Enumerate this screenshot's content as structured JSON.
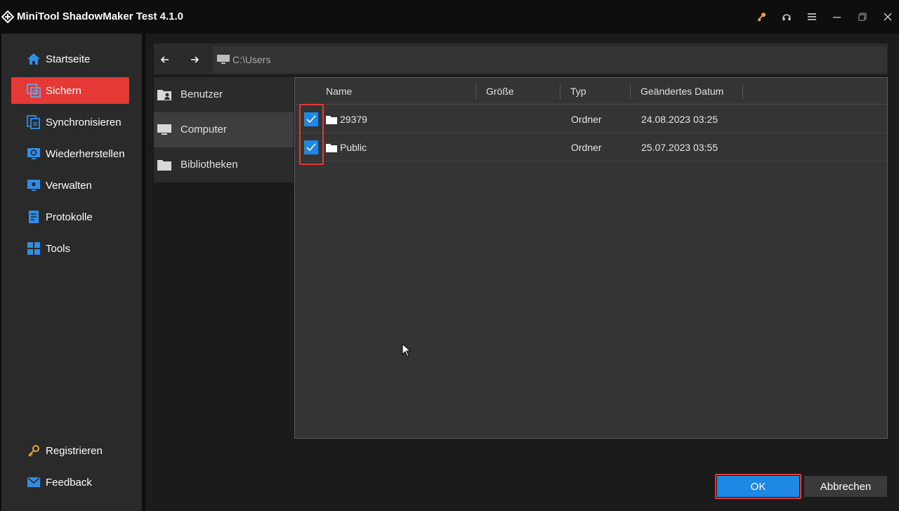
{
  "app": {
    "title": "MiniTool ShadowMaker Test 4.1.0"
  },
  "window_controls": [
    "key-icon",
    "headset-icon",
    "menu-icon",
    "minimize-icon",
    "restore-icon",
    "close-icon"
  ],
  "sidebar": {
    "items": [
      {
        "label": "Startseite",
        "icon": "home-icon",
        "active": false
      },
      {
        "label": "Sichern",
        "icon": "backup-icon",
        "active": true
      },
      {
        "label": "Synchronisieren",
        "icon": "sync-icon",
        "active": false
      },
      {
        "label": "Wiederherstellen",
        "icon": "restore-monitor-icon",
        "active": false
      },
      {
        "label": "Verwalten",
        "icon": "manage-icon",
        "active": false
      },
      {
        "label": "Protokolle",
        "icon": "log-icon",
        "active": false
      },
      {
        "label": "Tools",
        "icon": "tools-grid-icon",
        "active": false
      }
    ],
    "bottom_items": [
      {
        "label": "Registrieren",
        "icon": "key-icon"
      },
      {
        "label": "Feedback",
        "icon": "mail-icon"
      }
    ]
  },
  "navigation": {
    "path": "C:\\Users"
  },
  "locations": [
    {
      "label": "Benutzer",
      "icon": "user-folder-icon",
      "selected": false
    },
    {
      "label": "Computer",
      "icon": "computer-icon",
      "selected": true
    },
    {
      "label": "Bibliotheken",
      "icon": "folder-icon",
      "selected": false
    }
  ],
  "file_list": {
    "columns": [
      "Name",
      "Größe",
      "Typ",
      "Geändertes Datum"
    ],
    "rows": [
      {
        "checked": true,
        "name": "29379",
        "size": "",
        "type": "Ordner",
        "date": "24.08.2023 03:25"
      },
      {
        "checked": true,
        "name": "Public",
        "size": "",
        "type": "Ordner",
        "date": "25.07.2023 03:55"
      }
    ]
  },
  "buttons": {
    "ok": "OK",
    "cancel": "Abbrechen"
  },
  "colors": {
    "accent_red": "#e53935",
    "accent_blue": "#1e88e5",
    "nav_icon_blue": "#2f8ee6",
    "key_orange": "#e6a23c"
  }
}
